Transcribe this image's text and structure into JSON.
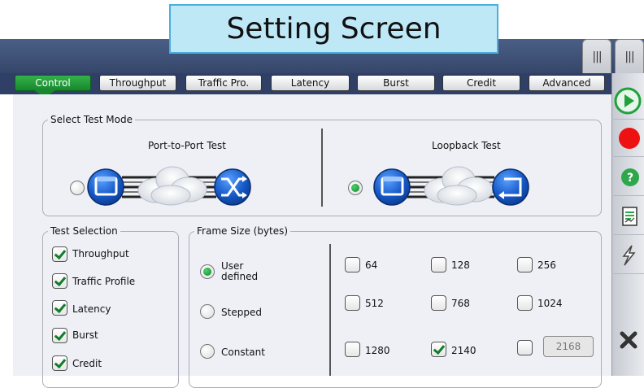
{
  "banner": {
    "title": "Setting Screen"
  },
  "handles": [
    "|||",
    "|||"
  ],
  "tabs": [
    {
      "label": "Control"
    },
    {
      "label": "Throughput"
    },
    {
      "label": "Traffic Pro."
    },
    {
      "label": "Latency"
    },
    {
      "label": "Burst"
    },
    {
      "label": "Credit"
    },
    {
      "label": "Advanced"
    }
  ],
  "test_mode": {
    "legend": "Select Test Mode",
    "port_to_port": {
      "label": "Port-to-Port Test",
      "selected": false
    },
    "loopback": {
      "label": "Loopback Test",
      "selected": true
    }
  },
  "test_selection": {
    "legend": "Test Selection",
    "items": [
      {
        "label": "Throughput",
        "checked": true
      },
      {
        "label": "Traffic Profile",
        "checked": true
      },
      {
        "label": "Latency",
        "checked": true
      },
      {
        "label": "Burst",
        "checked": true
      },
      {
        "label": "Credit",
        "checked": true
      }
    ]
  },
  "frame_size": {
    "legend": "Frame Size (bytes)",
    "modes": [
      {
        "label_line1": "User",
        "label_line2": "defined",
        "selected": true
      },
      {
        "label": "Stepped",
        "selected": false
      },
      {
        "label": "Constant",
        "selected": false
      }
    ],
    "sizes": [
      {
        "label": "64",
        "checked": false
      },
      {
        "label": "128",
        "checked": false
      },
      {
        "label": "256",
        "checked": false
      },
      {
        "label": "512",
        "checked": false
      },
      {
        "label": "768",
        "checked": false
      },
      {
        "label": "1024",
        "checked": false
      },
      {
        "label": "1280",
        "checked": false
      },
      {
        "label": "2140",
        "checked": true
      }
    ],
    "custom": {
      "checked": false,
      "value": "2168"
    }
  },
  "sidebar": {
    "icons": [
      "play-icon",
      "record-icon",
      "help-icon",
      "report-icon",
      "lightning-icon",
      "close-icon"
    ],
    "colors": {
      "play": "#1fa23b",
      "record": "#ee1111",
      "help": "#2ea84a",
      "close": "#333333"
    }
  },
  "colors": {
    "accent": "#17882e",
    "header": "#36466a",
    "banner": "#bfe8f7"
  }
}
